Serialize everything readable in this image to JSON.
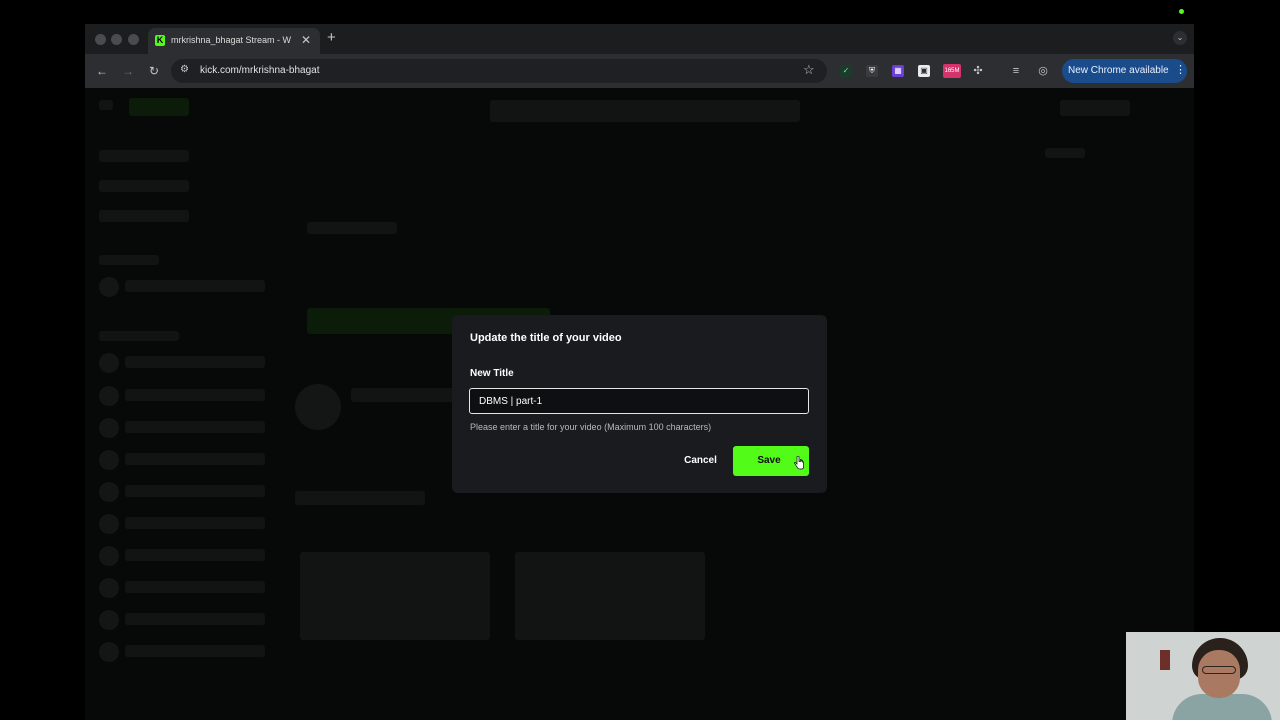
{
  "browser": {
    "tab_title": "mrkrishna_bhagat Stream - W",
    "tab_favicon": "K",
    "url": "kick.com/mrkrishna-bhagat",
    "update_label": "New Chrome available",
    "extension_badge": "165M"
  },
  "modal": {
    "title": "Update the title of your video",
    "field_label": "New Title",
    "input_value": "DBMS | part-1",
    "helper_text": "Please enter a title for your video (Maximum 100 characters)",
    "cancel_label": "Cancel",
    "save_label": "Save"
  },
  "colors": {
    "accent": "#53fc18",
    "modal_bg": "#191b1f",
    "browser_toolbar": "#2d2e31",
    "update_pill": "#1a4c8c"
  }
}
